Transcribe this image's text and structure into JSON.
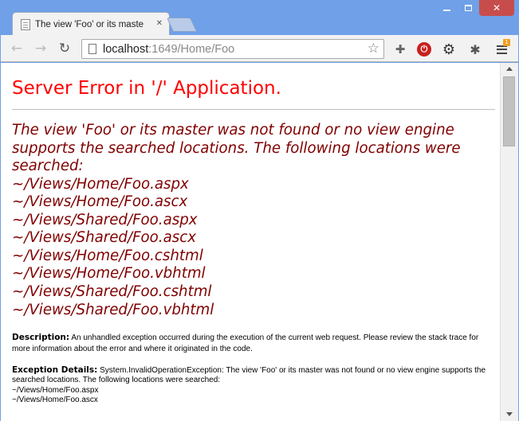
{
  "browser": {
    "tab_title": "The view 'Foo' or its maste",
    "url_host": "localhost",
    "url_path": ":1649/Home/Foo",
    "menu_badge": "1"
  },
  "page": {
    "title": "Server Error in '/' Application.",
    "message": "The view 'Foo' or its master was not found or no view engine supports the searched locations. The following locations were searched:",
    "locations": [
      "~/Views/Home/Foo.aspx",
      "~/Views/Home/Foo.ascx",
      "~/Views/Shared/Foo.aspx",
      "~/Views/Shared/Foo.ascx",
      "~/Views/Home/Foo.cshtml",
      "~/Views/Home/Foo.vbhtml",
      "~/Views/Shared/Foo.cshtml",
      "~/Views/Shared/Foo.vbhtml"
    ],
    "description_label": "Description:",
    "description_text": "An unhandled exception occurred during the execution of the current web request. Please review the stack trace for more information about the error and where it originated in the code.",
    "exception_label": "Exception Details:",
    "exception_text": "System.InvalidOperationException: The view 'Foo' or its master was not found or no view engine supports the searched locations. The following locations were searched:",
    "exception_locations": [
      "~/Views/Home/Foo.aspx",
      "~/Views/Home/Foo.ascx"
    ]
  },
  "colors": {
    "title": "#ff0000",
    "message": "#800000",
    "frame": "#6fa0e8"
  }
}
